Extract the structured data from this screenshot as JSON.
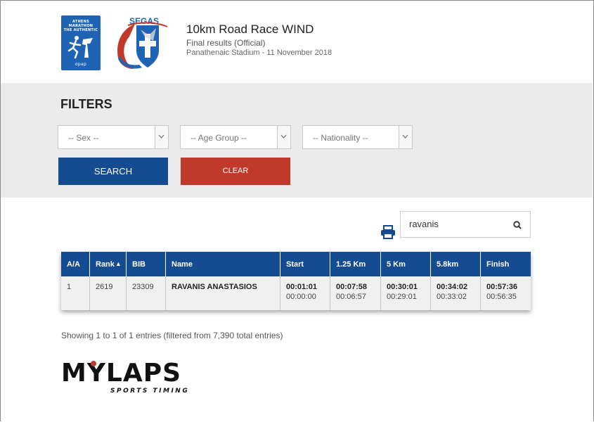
{
  "header": {
    "logo_athens_lines": [
      "ATHENS",
      "MARATHON",
      "THE AUTHENTIC"
    ],
    "logo_athens_sponsor": "opap",
    "logo_segas_text": "SEGAS",
    "title": "10km Road Race WIND",
    "subtitle": "Final results (Official)",
    "venue_date": "Panathenaic Stadium - 11 November 2018"
  },
  "filters": {
    "heading": "FILTERS",
    "sex": "-- Sex --",
    "age_group": "-- Age Group --",
    "nationality": "-- Nationality --",
    "search_label": "SEARCH",
    "clear_label": "CLEAR"
  },
  "search": {
    "value": "ravanis"
  },
  "table": {
    "columns": [
      "A/A",
      "Rank",
      "BIB",
      "Name",
      "Start",
      "1.25 Km",
      "5 Km",
      "5.8km",
      "Finish"
    ],
    "sort_indicator": "▲",
    "rows": [
      {
        "aa": "1",
        "rank": "2619",
        "bib": "23309",
        "name": "RAVANIS ANASTASIOS",
        "start_gun": "00:01:01",
        "start_net": "00:00:00",
        "km125_gun": "00:07:58",
        "km125_net": "00:06:57",
        "km5_gun": "00:30:01",
        "km5_net": "00:29:01",
        "km58_gun": "00:34:02",
        "km58_net": "00:33:02",
        "finish_gun": "00:57:36",
        "finish_net": "00:56:35"
      }
    ]
  },
  "info": "Showing 1 to 1 of 1 entries (filtered from 7,390 total entries)",
  "footer_logo": {
    "main": "MYLAPS",
    "tagline": "SPORTS TIMING"
  },
  "colors": {
    "primary": "#154b90",
    "danger": "#c0392b",
    "athens_blue": "#1f63b4",
    "filter_bg": "#ebebeb"
  }
}
